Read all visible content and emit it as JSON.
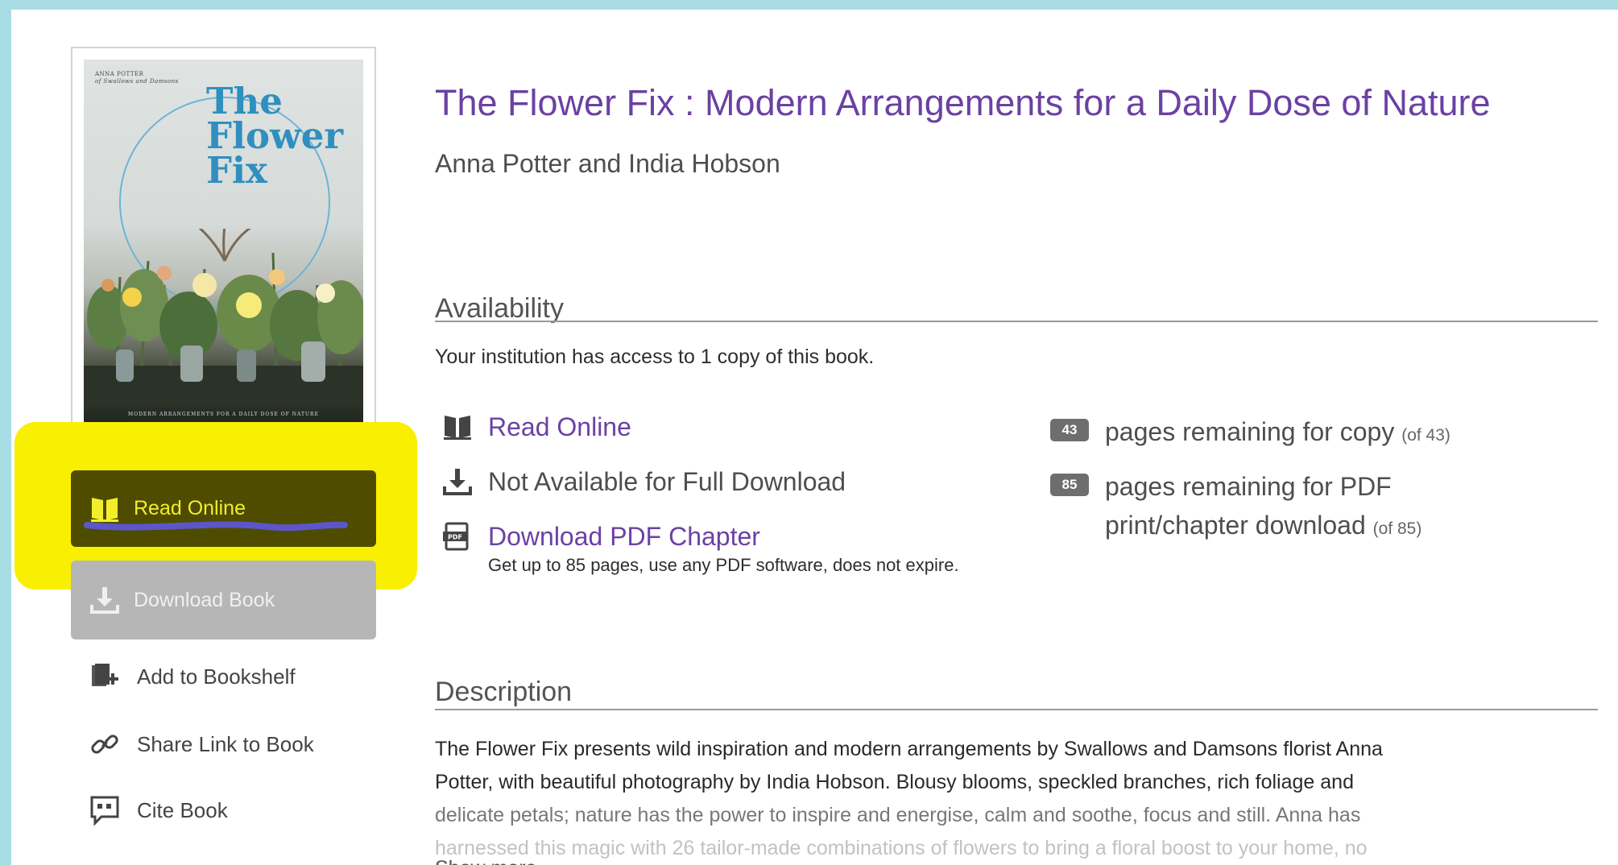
{
  "book": {
    "title": "The Flower Fix : Modern Arrangements for a Daily Dose of Nature",
    "authors": "Anna Potter and India Hobson",
    "cover": {
      "author_tiny": "ANNA POTTER",
      "author_tiny_2": "of Swallows and Damsons",
      "title_line1": "The",
      "title_line2": "Flower",
      "title_line3": "Fix",
      "subtitle": "MODERN ARRANGEMENTS FOR A DAILY DOSE OF NATURE"
    }
  },
  "sidebar": {
    "read_online": "Read Online",
    "download_book": "Download Book",
    "add_to_bookshelf": "Add to Bookshelf",
    "share_link": "Share Link to Book",
    "cite_book": "Cite Book"
  },
  "availability": {
    "heading": "Availability",
    "access_text": "Your institution has access to 1 copy of this book.",
    "read_online": "Read Online",
    "not_available": "Not Available for Full Download",
    "download_pdf_chapter": "Download PDF Chapter",
    "pdf_note": "Get up to 85 pages, use any PDF software, does not expire.",
    "copy_badge": "43",
    "copy_text": "pages remaining for copy",
    "copy_of": "(of 43)",
    "pdf_badge": "85",
    "pdf_text_1": "pages remaining for PDF",
    "pdf_text_2": "print/chapter download",
    "pdf_of": "(of 85)"
  },
  "description": {
    "heading": "Description",
    "line1": "The Flower Fix presents wild inspiration and modern arrangements by Swallows and Damsons florist Anna",
    "line2": "Potter, with beautiful photography by India Hobson. Blousy blooms, speckled branches, rich foliage and",
    "line3": "delicate petals; nature has the power to inspire and energise, calm and soothe, focus and still. Anna has",
    "line4": "harnessed this magic with 26 tailor-made combinations of flowers to bring a floral boost to your home, no",
    "show_more": "Show more"
  },
  "colors": {
    "background": "#a9dde6",
    "link_purple": "#6b41a3",
    "highlight": "#f8f000",
    "read_button": "#4f4c00"
  }
}
